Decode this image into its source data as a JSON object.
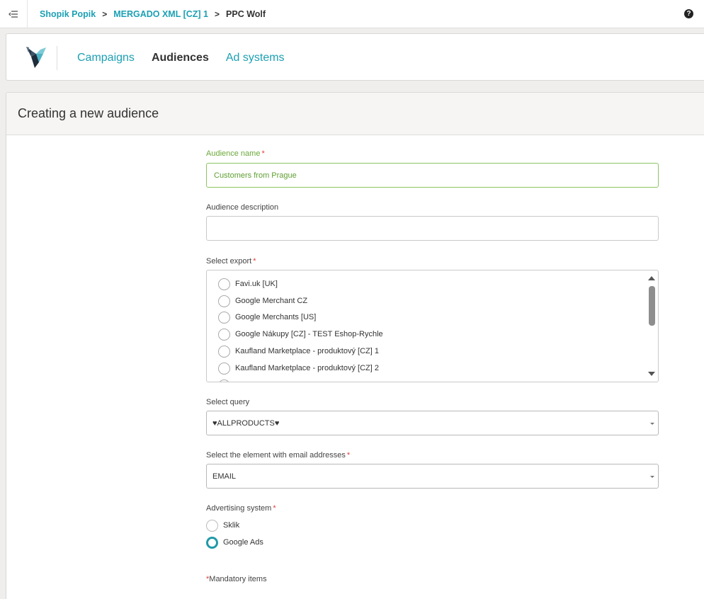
{
  "breadcrumb": {
    "items": [
      "Shopik Popik",
      "MERGADO XML [CZ] 1",
      "PPC Wolf"
    ],
    "separator": ">"
  },
  "help_icon_glyph": "?",
  "nav": {
    "tabs": [
      "Campaigns",
      "Audiences",
      "Ad systems"
    ],
    "active": "Audiences"
  },
  "page_title": "Creating a new audience",
  "form": {
    "audience_name": {
      "label": "Audience name",
      "required_mark": "*",
      "value": "Customers from Prague"
    },
    "audience_description": {
      "label": "Audience description",
      "value": ""
    },
    "select_export": {
      "label": "Select export",
      "required_mark": "*",
      "options": [
        "Favi.uk [UK]",
        "Google Merchant CZ",
        "Google Merchants [US]",
        "Google Nákupy [CZ] - TEST Eshop-Rychle",
        "Kaufland Marketplace - produktový [CZ] 1",
        "Kaufland Marketplace - produktový [CZ] 2"
      ]
    },
    "select_query": {
      "label": "Select query",
      "value": "♥ALLPRODUCTS♥"
    },
    "email_element": {
      "label": "Select the element with email addresses",
      "required_mark": "*",
      "value": "EMAIL"
    },
    "advertising_system": {
      "label": "Advertising system",
      "required_mark": "*",
      "options": [
        "Sklik",
        "Google Ads"
      ],
      "selected": "Google Ads"
    },
    "mandatory_note": {
      "mark": "*",
      "text": "Mandatory items"
    }
  },
  "colors": {
    "accent": "#1da0b4",
    "valid": "#6aa83a",
    "required": "#e03c3c",
    "radio_checked": "#1f9aa8"
  },
  "icons": {
    "menu": "menu-collapse-icon",
    "help": "help-icon",
    "logo": "wolf-logo"
  }
}
